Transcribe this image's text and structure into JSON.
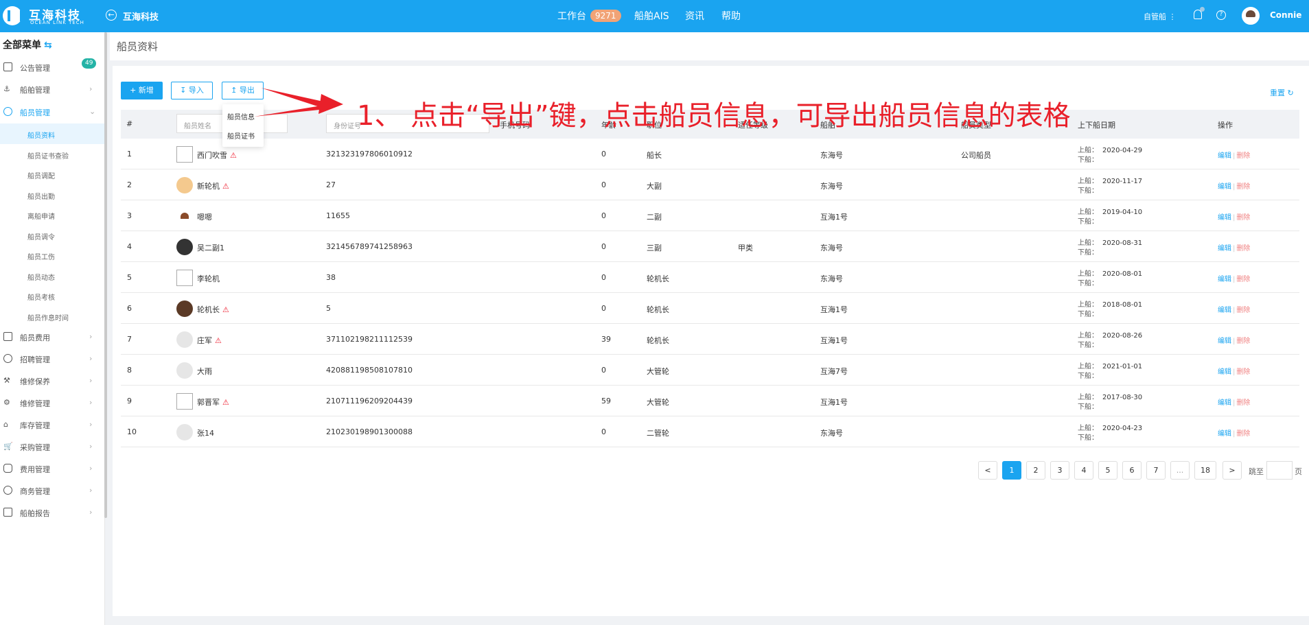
{
  "header": {
    "brand_cn": "互海科技",
    "brand_en": "OCEAN LINK TECH",
    "app_title": "互海科技",
    "nav": [
      "工作台",
      "船舶AIS",
      "资讯",
      "帮助"
    ],
    "workbench_badge": "9271",
    "role": "自管船",
    "user": "Connie"
  },
  "sidebar": {
    "title": "全部菜单",
    "badge": "49",
    "items": [
      {
        "label": "公告管理"
      },
      {
        "label": "船舶管理"
      },
      {
        "label": "船员管理"
      }
    ],
    "subitems": [
      "船员资料",
      "船员证书查验",
      "船员调配",
      "船员出勤",
      "离船申请",
      "船员调令",
      "船员工伤",
      "船员动态",
      "船员考核",
      "船员作息时间"
    ],
    "items2": [
      {
        "label": "船员费用"
      },
      {
        "label": "招聘管理"
      },
      {
        "label": "维修保养"
      },
      {
        "label": "维修管理"
      },
      {
        "label": "库存管理"
      },
      {
        "label": "采购管理"
      },
      {
        "label": "费用管理"
      },
      {
        "label": "商务管理"
      },
      {
        "label": "船舶报告"
      }
    ]
  },
  "page": {
    "title": "船员资料",
    "buttons": {
      "add": "+ 新增",
      "import": "导入",
      "export": "导出"
    },
    "reset": "重置",
    "export_menu": [
      "船员信息",
      "船员证书"
    ],
    "annotation": "1、 点击“导出”键，点击船员信息，可导出船员信息的表格"
  },
  "table": {
    "headers": {
      "index": "#",
      "name_ph": "船员姓名",
      "id_ph": "身份证号",
      "phone": "手机号码",
      "age": "年龄",
      "post": "职位",
      "grade": "适任等级",
      "ship": "船舶",
      "type": "船员类型",
      "date": "上下船日期",
      "ops": "操作"
    },
    "rows": [
      {
        "no": "1",
        "name": "西门吹雪",
        "warn": true,
        "id": "321323197806010912",
        "age": "0",
        "post": "船长",
        "grade": "",
        "ship": "东海号",
        "type": "公司船员",
        "on": "2020-04-29"
      },
      {
        "no": "2",
        "name": "新轮机",
        "warn": true,
        "id": "27",
        "age": "0",
        "post": "大副",
        "grade": "",
        "ship": "东海号",
        "type": "",
        "on": "2020-11-17"
      },
      {
        "no": "3",
        "name": "嗯嗯",
        "warn": false,
        "id": "11655",
        "age": "0",
        "post": "二副",
        "grade": "",
        "ship": "互海1号",
        "type": "",
        "on": "2019-04-10"
      },
      {
        "no": "4",
        "name": "吴二副1",
        "warn": false,
        "id": "321456789741258963",
        "age": "0",
        "post": "三副",
        "grade": "甲类",
        "ship": "东海号",
        "type": "",
        "on": "2020-08-31"
      },
      {
        "no": "5",
        "name": "李轮机",
        "warn": false,
        "id": "38",
        "age": "0",
        "post": "轮机长",
        "grade": "",
        "ship": "东海号",
        "type": "",
        "on": "2020-08-01"
      },
      {
        "no": "6",
        "name": "轮机长",
        "warn": true,
        "id": "5",
        "age": "0",
        "post": "轮机长",
        "grade": "",
        "ship": "互海1号",
        "type": "",
        "on": "2018-08-01"
      },
      {
        "no": "7",
        "name": "庄军",
        "warn": true,
        "id": "371102198211112539",
        "age": "39",
        "post": "轮机长",
        "grade": "",
        "ship": "互海1号",
        "type": "",
        "on": "2020-08-26"
      },
      {
        "no": "8",
        "name": "大雨",
        "warn": false,
        "id": "420881198508107810",
        "age": "0",
        "post": "大管轮",
        "grade": "",
        "ship": "互海7号",
        "type": "",
        "on": "2021-01-01"
      },
      {
        "no": "9",
        "name": "郭晋军",
        "warn": true,
        "id": "210711196209204439",
        "age": "59",
        "post": "大管轮",
        "grade": "",
        "ship": "互海1号",
        "type": "",
        "on": "2017-08-30"
      },
      {
        "no": "10",
        "name": "张14",
        "warn": false,
        "id": "210230198901300088",
        "age": "0",
        "post": "二管轮",
        "grade": "",
        "ship": "东海号",
        "type": "",
        "on": "2020-04-23"
      }
    ],
    "on_label": "上船：",
    "off_label": "下船：",
    "edit": "编辑",
    "sep": "|",
    "delete": "删除"
  },
  "pagination": {
    "prev": "<",
    "next": ">",
    "pages": [
      "1",
      "2",
      "3",
      "4",
      "5",
      "6",
      "7",
      "...",
      "18"
    ],
    "jump_label": "跳至",
    "page_unit": "页"
  },
  "colors": {
    "primary": "#1aa4f0",
    "annotation": "#e9202a"
  },
  "icons": {
    "back": "back-circle-icon",
    "bell": "bell-icon",
    "help": "help-icon"
  }
}
